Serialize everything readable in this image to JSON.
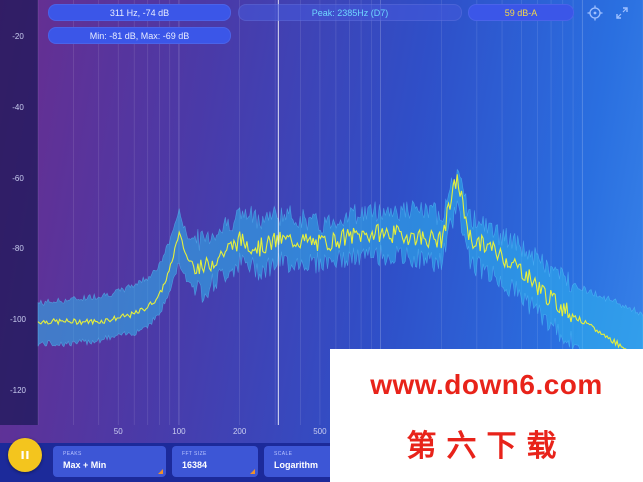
{
  "readouts": {
    "cursor": "311 Hz, -74 dB",
    "minmax": "Min: -81 dB, Max: -69 dB",
    "peak": "Peak: 2385Hz (D7)",
    "level": "59 dB-A"
  },
  "icons": {
    "target": "crosshair-icon",
    "expand": "expand-icon",
    "pause": "pause-icon"
  },
  "controls": [
    {
      "caption": "PEAKS",
      "value": "Max + Min"
    },
    {
      "caption": "FFT SIZE",
      "value": "16384"
    },
    {
      "caption": "SCALE",
      "value": "Logarithm"
    }
  ],
  "watermark": {
    "url": "www.down6.com",
    "cn": "第六下载"
  },
  "colors": {
    "trace": "#e6f03a",
    "band": "#2fb6ee",
    "pause": "#f3c51e",
    "accent_corner": "#f0902a"
  },
  "chart_data": {
    "type": "line",
    "xscale": "log",
    "x_ticks": [
      50,
      100,
      200,
      500
    ],
    "y_ticks": [
      -20,
      -40,
      -60,
      -80,
      -100,
      -120
    ],
    "xlim": [
      20,
      20000
    ],
    "ylim": [
      -130,
      -15
    ],
    "cursor_hz": 311,
    "x": [
      20,
      30,
      40,
      50,
      60,
      70,
      80,
      90,
      100,
      110,
      130,
      160,
      200,
      250,
      311,
      400,
      500,
      700,
      1000,
      1500,
      2000,
      2385,
      2800,
      3500,
      5000,
      7000,
      10000,
      15000,
      20000
    ],
    "series": [
      {
        "values": [
          -102,
          -102,
          -102,
          -101,
          -100,
          -98,
          -95,
          -88,
          -78,
          -85,
          -88,
          -84,
          -80,
          -82,
          -80,
          -80,
          -81,
          -79,
          -78,
          -79,
          -80,
          -63,
          -80,
          -82,
          -88,
          -96,
          -102,
          -108,
          -112
        ]
      },
      {
        "values": [
          -97,
          -96,
          -95,
          -94,
          -92,
          -90,
          -87,
          -80,
          -72,
          -79,
          -80,
          -77,
          -73,
          -74,
          -73,
          -74,
          -76,
          -73,
          -72,
          -72,
          -73,
          -62,
          -74,
          -77,
          -82,
          -88,
          -93,
          -97,
          -100
        ]
      },
      {
        "values": [
          -108,
          -108,
          -107,
          -106,
          -105,
          -103,
          -100,
          -94,
          -86,
          -91,
          -94,
          -90,
          -86,
          -88,
          -86,
          -86,
          -86,
          -85,
          -84,
          -85,
          -86,
          -70,
          -86,
          -89,
          -95,
          -103,
          -110,
          -116,
          -120
        ]
      }
    ]
  }
}
